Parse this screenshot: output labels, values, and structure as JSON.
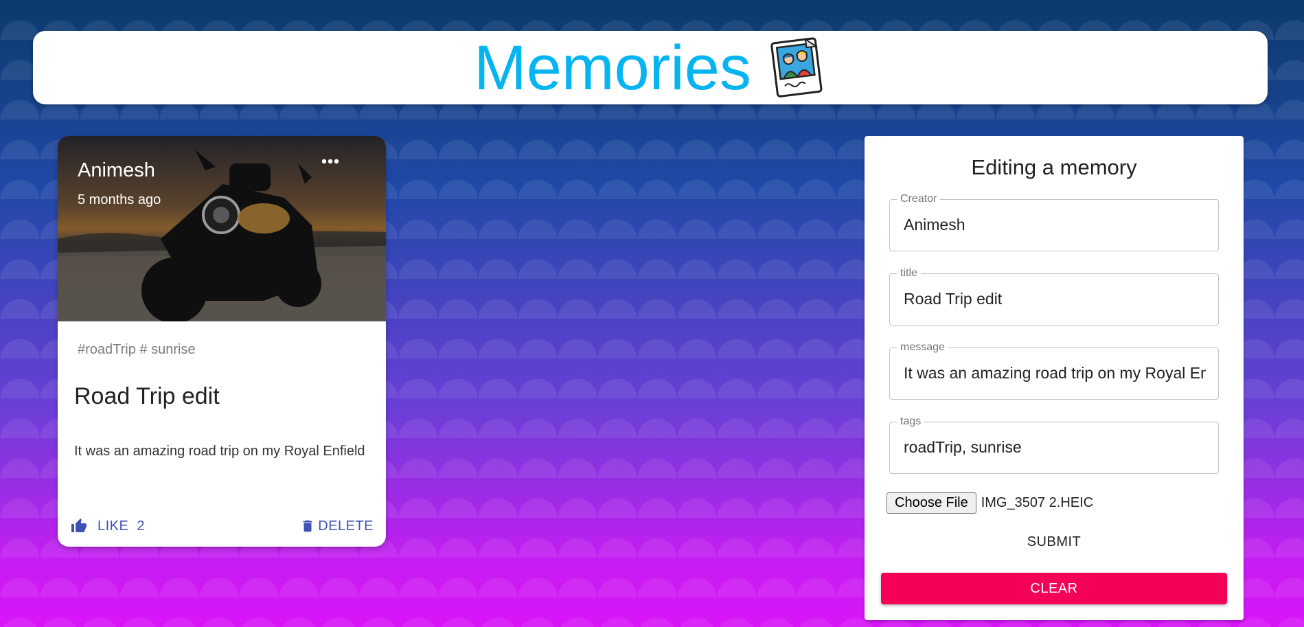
{
  "app": {
    "title": "Memories",
    "logo_icon": "polaroid-photo-icon"
  },
  "colors": {
    "brand": "#06b4f2",
    "primary": "#3f51b5",
    "secondary": "#f50057",
    "background_top": "#0b3a6b",
    "background_bottom": "#d815f7"
  },
  "post": {
    "creator": "Animesh",
    "time": "5 months ago",
    "more_icon": "more-horizontal-icon",
    "tags": "#roadTrip # sunrise",
    "title": "Road Trip edit",
    "message": "It was an amazing road trip on my Royal Enfield",
    "like_label": "LIKE",
    "like_count": "2",
    "delete_label": "DELETE"
  },
  "form": {
    "heading": "Editing a memory",
    "creator": {
      "label": "Creator",
      "value": "Animesh"
    },
    "title": {
      "label": "title",
      "value": "Road Trip edit"
    },
    "message": {
      "label": "message",
      "value": "It was an amazing road trip on my Royal Enfield"
    },
    "tags": {
      "label": "tags",
      "value": "roadTrip, sunrise"
    },
    "file_button": "Choose File",
    "file_name": "IMG_3507 2.HEIC",
    "submit_label": "SUBMIT",
    "clear_label": "CLEAR"
  }
}
